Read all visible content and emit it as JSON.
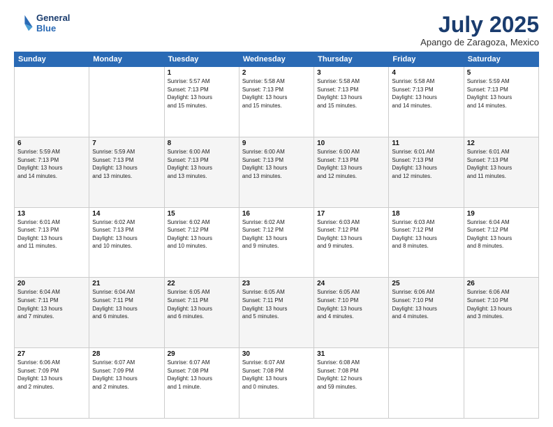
{
  "logo": {
    "line1": "General",
    "line2": "Blue"
  },
  "title": "July 2025",
  "location": "Apango de Zaragoza, Mexico",
  "days_of_week": [
    "Sunday",
    "Monday",
    "Tuesday",
    "Wednesday",
    "Thursday",
    "Friday",
    "Saturday"
  ],
  "weeks": [
    [
      {
        "day": "",
        "info": ""
      },
      {
        "day": "",
        "info": ""
      },
      {
        "day": "1",
        "info": "Sunrise: 5:57 AM\nSunset: 7:13 PM\nDaylight: 13 hours\nand 15 minutes."
      },
      {
        "day": "2",
        "info": "Sunrise: 5:58 AM\nSunset: 7:13 PM\nDaylight: 13 hours\nand 15 minutes."
      },
      {
        "day": "3",
        "info": "Sunrise: 5:58 AM\nSunset: 7:13 PM\nDaylight: 13 hours\nand 15 minutes."
      },
      {
        "day": "4",
        "info": "Sunrise: 5:58 AM\nSunset: 7:13 PM\nDaylight: 13 hours\nand 14 minutes."
      },
      {
        "day": "5",
        "info": "Sunrise: 5:59 AM\nSunset: 7:13 PM\nDaylight: 13 hours\nand 14 minutes."
      }
    ],
    [
      {
        "day": "6",
        "info": "Sunrise: 5:59 AM\nSunset: 7:13 PM\nDaylight: 13 hours\nand 14 minutes."
      },
      {
        "day": "7",
        "info": "Sunrise: 5:59 AM\nSunset: 7:13 PM\nDaylight: 13 hours\nand 13 minutes."
      },
      {
        "day": "8",
        "info": "Sunrise: 6:00 AM\nSunset: 7:13 PM\nDaylight: 13 hours\nand 13 minutes."
      },
      {
        "day": "9",
        "info": "Sunrise: 6:00 AM\nSunset: 7:13 PM\nDaylight: 13 hours\nand 13 minutes."
      },
      {
        "day": "10",
        "info": "Sunrise: 6:00 AM\nSunset: 7:13 PM\nDaylight: 13 hours\nand 12 minutes."
      },
      {
        "day": "11",
        "info": "Sunrise: 6:01 AM\nSunset: 7:13 PM\nDaylight: 13 hours\nand 12 minutes."
      },
      {
        "day": "12",
        "info": "Sunrise: 6:01 AM\nSunset: 7:13 PM\nDaylight: 13 hours\nand 11 minutes."
      }
    ],
    [
      {
        "day": "13",
        "info": "Sunrise: 6:01 AM\nSunset: 7:13 PM\nDaylight: 13 hours\nand 11 minutes."
      },
      {
        "day": "14",
        "info": "Sunrise: 6:02 AM\nSunset: 7:13 PM\nDaylight: 13 hours\nand 10 minutes."
      },
      {
        "day": "15",
        "info": "Sunrise: 6:02 AM\nSunset: 7:12 PM\nDaylight: 13 hours\nand 10 minutes."
      },
      {
        "day": "16",
        "info": "Sunrise: 6:02 AM\nSunset: 7:12 PM\nDaylight: 13 hours\nand 9 minutes."
      },
      {
        "day": "17",
        "info": "Sunrise: 6:03 AM\nSunset: 7:12 PM\nDaylight: 13 hours\nand 9 minutes."
      },
      {
        "day": "18",
        "info": "Sunrise: 6:03 AM\nSunset: 7:12 PM\nDaylight: 13 hours\nand 8 minutes."
      },
      {
        "day": "19",
        "info": "Sunrise: 6:04 AM\nSunset: 7:12 PM\nDaylight: 13 hours\nand 8 minutes."
      }
    ],
    [
      {
        "day": "20",
        "info": "Sunrise: 6:04 AM\nSunset: 7:11 PM\nDaylight: 13 hours\nand 7 minutes."
      },
      {
        "day": "21",
        "info": "Sunrise: 6:04 AM\nSunset: 7:11 PM\nDaylight: 13 hours\nand 6 minutes."
      },
      {
        "day": "22",
        "info": "Sunrise: 6:05 AM\nSunset: 7:11 PM\nDaylight: 13 hours\nand 6 minutes."
      },
      {
        "day": "23",
        "info": "Sunrise: 6:05 AM\nSunset: 7:11 PM\nDaylight: 13 hours\nand 5 minutes."
      },
      {
        "day": "24",
        "info": "Sunrise: 6:05 AM\nSunset: 7:10 PM\nDaylight: 13 hours\nand 4 minutes."
      },
      {
        "day": "25",
        "info": "Sunrise: 6:06 AM\nSunset: 7:10 PM\nDaylight: 13 hours\nand 4 minutes."
      },
      {
        "day": "26",
        "info": "Sunrise: 6:06 AM\nSunset: 7:10 PM\nDaylight: 13 hours\nand 3 minutes."
      }
    ],
    [
      {
        "day": "27",
        "info": "Sunrise: 6:06 AM\nSunset: 7:09 PM\nDaylight: 13 hours\nand 2 minutes."
      },
      {
        "day": "28",
        "info": "Sunrise: 6:07 AM\nSunset: 7:09 PM\nDaylight: 13 hours\nand 2 minutes."
      },
      {
        "day": "29",
        "info": "Sunrise: 6:07 AM\nSunset: 7:08 PM\nDaylight: 13 hours\nand 1 minute."
      },
      {
        "day": "30",
        "info": "Sunrise: 6:07 AM\nSunset: 7:08 PM\nDaylight: 13 hours\nand 0 minutes."
      },
      {
        "day": "31",
        "info": "Sunrise: 6:08 AM\nSunset: 7:08 PM\nDaylight: 12 hours\nand 59 minutes."
      },
      {
        "day": "",
        "info": ""
      },
      {
        "day": "",
        "info": ""
      }
    ]
  ]
}
